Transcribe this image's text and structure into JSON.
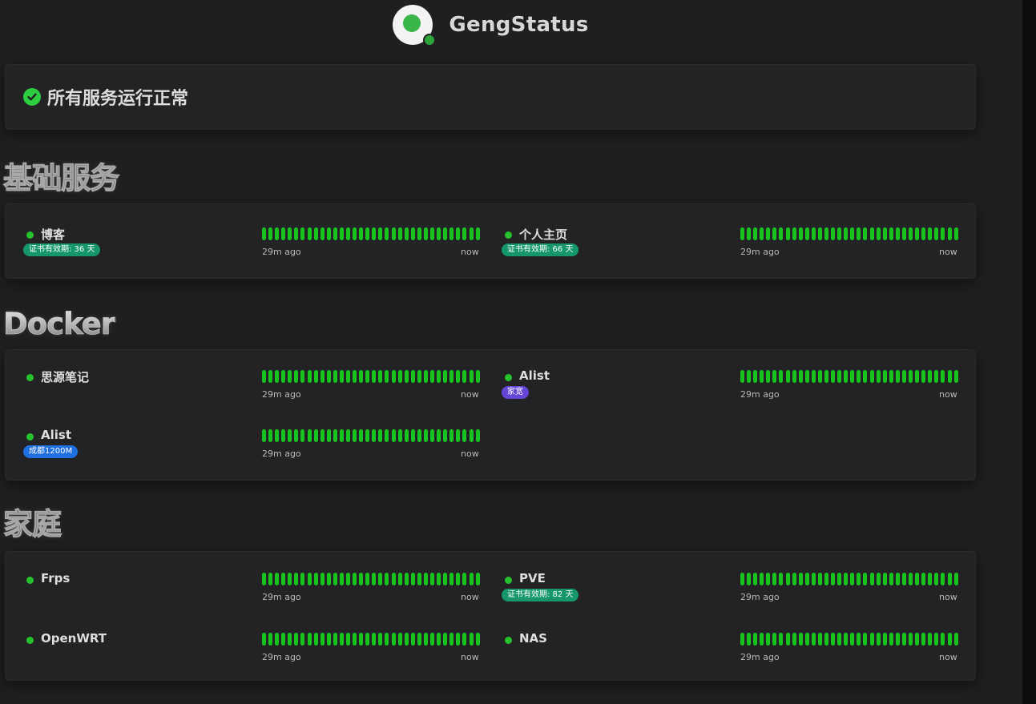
{
  "header": {
    "brand": "GengStatus"
  },
  "overall": {
    "status_text": "所有服务运行正常"
  },
  "time_labels": {
    "start": "29m ago",
    "end": "now"
  },
  "colors": {
    "up": "#19c31f",
    "tag_green": "#15976b",
    "tag_purple": "#6546d6",
    "tag_blue": "#1f6fe0"
  },
  "groups": [
    {
      "title": "基础服务",
      "monitors": [
        {
          "name": "博客",
          "tag": "证书有效期: 36 天"
        },
        {
          "name": "个人主页",
          "tag": "证书有效期: 66 天"
        }
      ]
    },
    {
      "title": "Docker",
      "monitors": [
        {
          "name": "思源笔记"
        },
        {
          "name": "Alist",
          "tag": "家宽"
        },
        {
          "name": "Alist",
          "tag": "成都1200M"
        }
      ]
    },
    {
      "title": "家庭",
      "monitors": [
        {
          "name": "Frps"
        },
        {
          "name": "PVE",
          "tag": "证书有效期: 82 天"
        },
        {
          "name": "OpenWRT"
        },
        {
          "name": "NAS"
        }
      ]
    }
  ]
}
